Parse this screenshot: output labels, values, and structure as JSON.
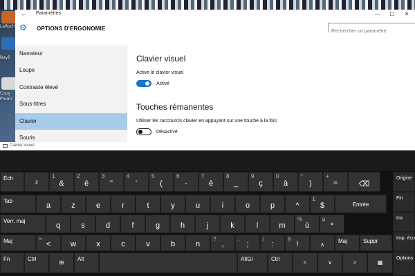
{
  "desktop": {
    "icon_labels": [
      "LaRoch",
      "",
      "Bayli",
      "Copy",
      "Premi"
    ]
  },
  "settings": {
    "window_title": "Paramètres",
    "back_icon": "back-arrow-icon",
    "header_title": "OPTIONS D'ERGONOMIE",
    "search_placeholder": "Rechercher un paramètre",
    "window_controls": {
      "minimize": "—",
      "maximize": "☐",
      "close": "✕"
    },
    "sidebar": [
      "Narrateur",
      "Loupe",
      "Contraste élevé",
      "Sous-titres",
      "Clavier",
      "Souris"
    ],
    "active_item": "Clavier",
    "sections": [
      {
        "title": "Clavier visuel",
        "label": "Active le clavier visuel",
        "state": "Activé",
        "on": true
      },
      {
        "title": "Touches rémanentes",
        "label": "Utiliser les raccourcis clavier en appuyant sur une touche à la fois",
        "state": "Désactivé",
        "on": false
      }
    ],
    "accent": "#1a73c8"
  },
  "osk": {
    "title": "Clavier visuel",
    "row1": [
      {
        "main": "Éch",
        "sup": "",
        "kind": "label"
      },
      {
        "main": "²",
        "sup": ""
      },
      {
        "main": "&",
        "sup": "1"
      },
      {
        "main": "é",
        "sup": "2"
      },
      {
        "main": "\"",
        "sup": "3"
      },
      {
        "main": "'",
        "sup": "4"
      },
      {
        "main": "(",
        "sup": "5"
      },
      {
        "main": "-",
        "sup": "6"
      },
      {
        "main": "è",
        "sup": "7"
      },
      {
        "main": "_",
        "sup": "8"
      },
      {
        "main": "ç",
        "sup": "9"
      },
      {
        "main": "à",
        "sup": "0"
      },
      {
        "main": ")",
        "sup": "°"
      },
      {
        "main": "=",
        "sup": "+"
      },
      {
        "main": "⌫",
        "sup": ""
      }
    ],
    "row2": [
      {
        "main": "Tab",
        "kind": "label"
      },
      {
        "main": "a"
      },
      {
        "main": "z"
      },
      {
        "main": "e"
      },
      {
        "main": "r"
      },
      {
        "main": "t"
      },
      {
        "main": "y"
      },
      {
        "main": "u"
      },
      {
        "main": "i"
      },
      {
        "main": "o"
      },
      {
        "main": "p"
      },
      {
        "main": "^",
        "sup": ""
      },
      {
        "main": "$",
        "sup": "£"
      },
      {
        "main": "Entrée",
        "kind": "center"
      }
    ],
    "row3": [
      {
        "main": "Verr. maj",
        "kind": "label"
      },
      {
        "main": "q"
      },
      {
        "main": "s"
      },
      {
        "main": "d"
      },
      {
        "main": "f"
      },
      {
        "main": "g"
      },
      {
        "main": "h"
      },
      {
        "main": "j"
      },
      {
        "main": "k"
      },
      {
        "main": "l"
      },
      {
        "main": "m"
      },
      {
        "main": "ù",
        "sup": "%"
      },
      {
        "main": "*",
        "sup": "µ"
      }
    ],
    "row4": [
      {
        "main": "Maj",
        "kind": "label"
      },
      {
        "main": "<",
        "sup": ">"
      },
      {
        "main": "w"
      },
      {
        "main": "x"
      },
      {
        "main": "c"
      },
      {
        "main": "v"
      },
      {
        "main": "b"
      },
      {
        "main": "n"
      },
      {
        "main": ",",
        "sup": "?"
      },
      {
        "main": ";",
        "sup": "."
      },
      {
        "main": ":",
        "sup": "/"
      },
      {
        "main": "!",
        "sup": "§"
      },
      {
        "main": "∧",
        "kind": "center"
      },
      {
        "main": "Maj",
        "kind": "label"
      },
      {
        "main": "Suppr",
        "kind": "label"
      }
    ],
    "row5": [
      {
        "main": "Fn",
        "kind": "label"
      },
      {
        "main": "Ctrl",
        "kind": "label"
      },
      {
        "main": "⊞",
        "kind": "center"
      },
      {
        "main": "Alt",
        "kind": "label"
      },
      {
        "main": "",
        "kind": "label"
      },
      {
        "main": "AltGr",
        "kind": "label"
      },
      {
        "main": "Ctrl",
        "kind": "label"
      },
      {
        "main": "<",
        "kind": "center"
      },
      {
        "main": "∨",
        "kind": "center"
      },
      {
        "main": ">",
        "kind": "center"
      },
      {
        "main": "▦",
        "kind": "center"
      }
    ],
    "side": [
      "Origine",
      "Fin",
      "Ins",
      "Imp. écra",
      "Options"
    ]
  }
}
